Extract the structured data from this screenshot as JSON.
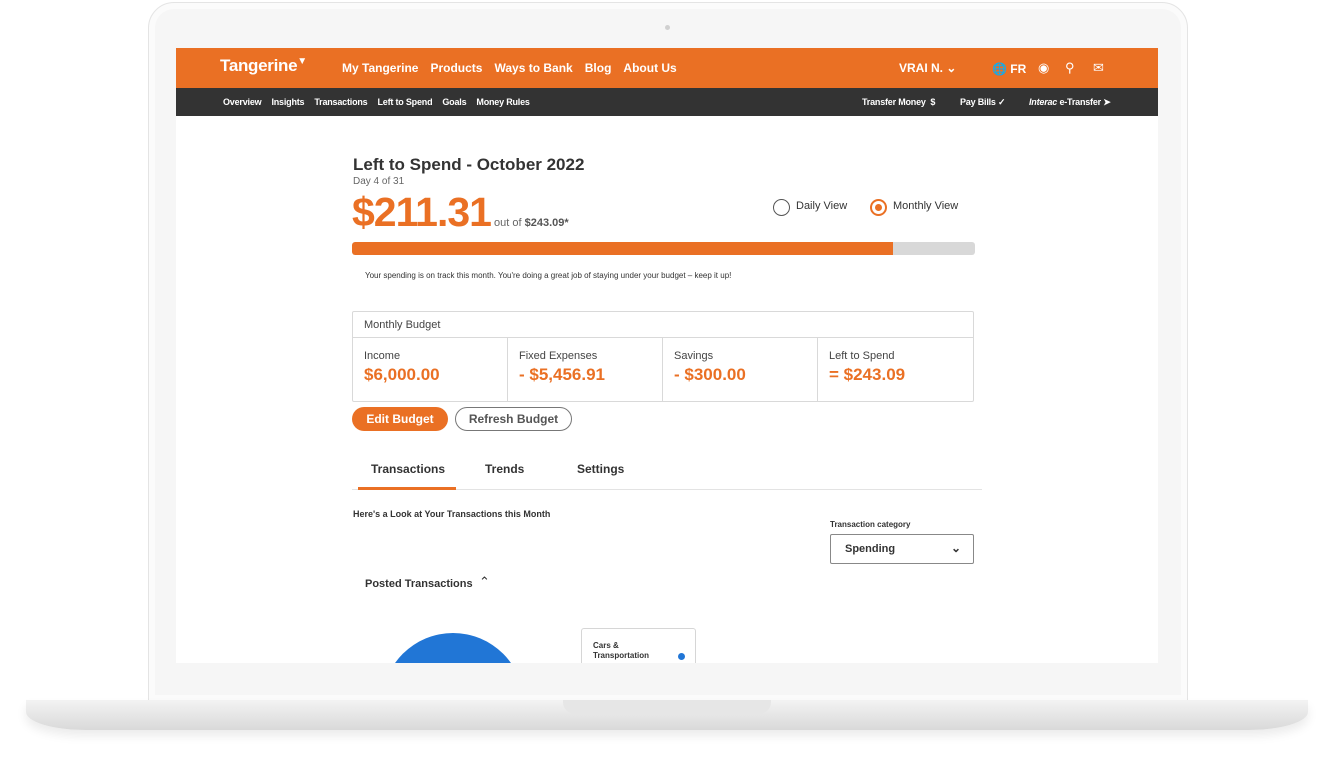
{
  "header": {
    "logo": "Tangerine",
    "nav": [
      "My Tangerine",
      "Products",
      "Ways to Bank",
      "Blog",
      "About Us"
    ],
    "user": "VRAI N.",
    "language": "FR",
    "icons": [
      "location-pin-icon",
      "search-icon",
      "mail-icon"
    ]
  },
  "subnav": {
    "items": [
      "Overview",
      "Insights",
      "Transactions",
      "Left to Spend",
      "Goals",
      "Money Rules"
    ],
    "transfer_money": "Transfer Money",
    "pay_bills": "Pay Bills",
    "etransfer_brand": "Interac",
    "etransfer_suffix": "e-Transfer"
  },
  "summary": {
    "title": "Left to Spend - October 2022",
    "day_progress": "Day 4 of 31",
    "amount": "$211.31",
    "out_of_prefix": "out of",
    "out_of_value": "$243.09*",
    "progress_fraction": 0.869,
    "message": "Your spending is on track this month. You're doing a great job of staying under your budget – keep it up!"
  },
  "view_toggle": {
    "daily": "Daily View",
    "monthly": "Monthly View",
    "selected": "monthly"
  },
  "budget": {
    "heading": "Monthly Budget",
    "cells": [
      {
        "label": "Income",
        "value": "$6,000.00"
      },
      {
        "label": "Fixed Expenses",
        "value": "- $5,456.91"
      },
      {
        "label": "Savings",
        "value": "- $300.00"
      },
      {
        "label": "Left to Spend",
        "value": "= $243.09"
      }
    ],
    "edit_label": "Edit Budget",
    "refresh_label": "Refresh Budget"
  },
  "tabs": [
    "Transactions",
    "Trends",
    "Settings"
  ],
  "transactions": {
    "section_title": "Here's a Look at Your Transactions this Month",
    "category_label": "Transaction category",
    "category_value": "Spending",
    "posted_label": "Posted Transactions",
    "legend_item": "Cars & Transportation"
  },
  "colors": {
    "brand": "#ea7024",
    "nav_dark": "#333333",
    "chart_blue": "#2176d6"
  }
}
